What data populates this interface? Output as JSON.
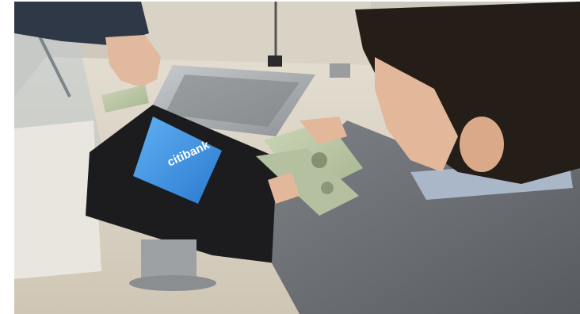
{
  "photo": {
    "subject": "",
    "screen_logo_text": "citibank",
    "colors": {
      "counter": "#d9d2c3",
      "sweater": "#6f7378",
      "hair": "#241d18",
      "skin": "#e3b79a",
      "screen": "#3a8fe0",
      "bill": "#b9c6a6",
      "metal": "#a9adb0",
      "device": "#1c1c1e"
    }
  }
}
